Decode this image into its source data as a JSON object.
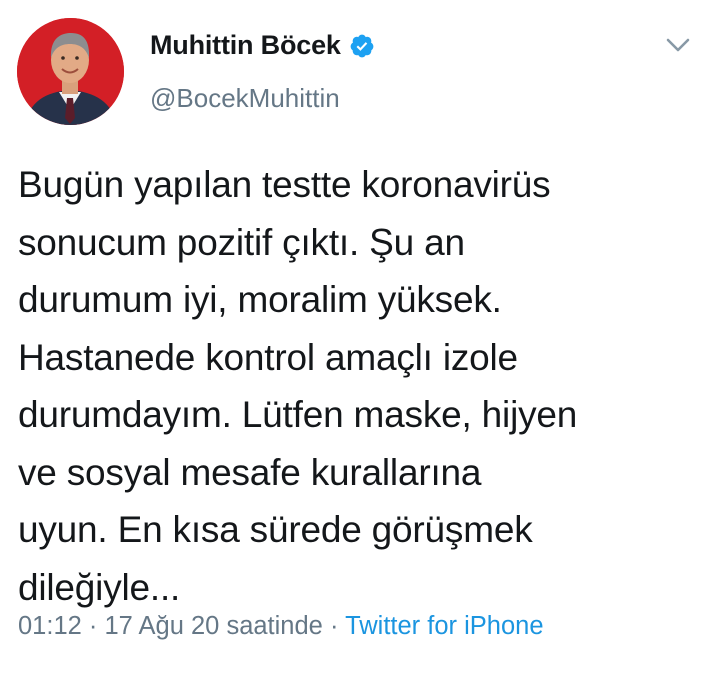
{
  "author": {
    "display_name": "Muhittin Böcek",
    "handle": "@BocekMuhittin",
    "verified_icon": "verified-badge-icon",
    "avatar_icon": "profile-photo"
  },
  "tweet": {
    "text": "Bugün yapılan testte koronavirüs\nsonucum pozitif çıktı. Şu an\ndurumum iyi, moralim yüksek.\nHastanede kontrol amaçlı izole\ndurumdayım. Lütfen maske, hijyen\nve sosyal mesafe kurallarına\nuyun. En kısa sürede görüşmek\ndileğiyle...",
    "time": "01:12",
    "separator": "·",
    "date": "17 Ağu 20 saatinde",
    "source": "Twitter for iPhone"
  },
  "menu": {
    "icon": "chevron-down-icon"
  },
  "colors": {
    "text": "#14171a",
    "secondary": "#657786",
    "link": "#1b95e0",
    "verified": "#1da1f2"
  }
}
